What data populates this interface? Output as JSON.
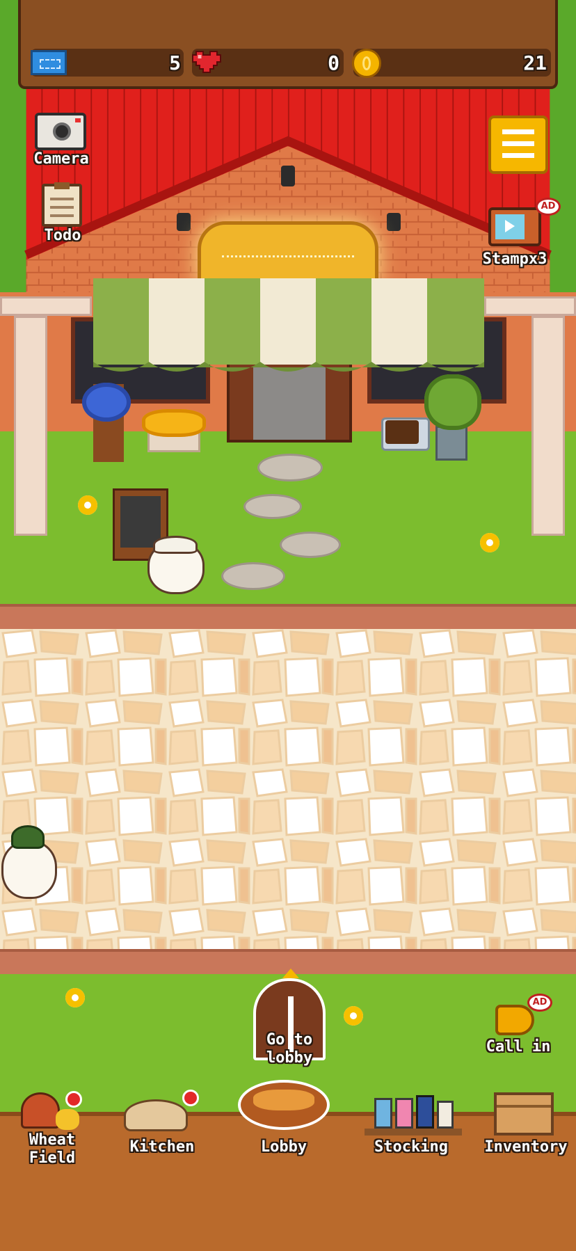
{
  "hud": {
    "tickets": "5",
    "hearts": "0",
    "coins": "21"
  },
  "side_buttons": {
    "camera": "Camera",
    "todo": "Todo",
    "stamp": "Stampx3",
    "stamp_badge": "AD",
    "menu_icon": "hamburger-menu-icon"
  },
  "scene": {
    "go_lobby": "Go to\nlobby",
    "call_in": "Call in",
    "call_in_badge": "AD"
  },
  "bottom_nav": [
    {
      "label": "Wheat\nField",
      "icon": "wheat-icon"
    },
    {
      "label": "Kitchen",
      "icon": "kitchen-icon"
    },
    {
      "label": "Lobby",
      "icon": "bread-basket-icon"
    },
    {
      "label": "Stocking",
      "icon": "shelf-icon"
    },
    {
      "label": "Inventory",
      "icon": "box-icon"
    }
  ],
  "colors": {
    "roof": "#e0201c",
    "awning_green": "#8cb04a",
    "awning_white": "#f2ead4",
    "grass": "#7cbd2e",
    "wood": "#b96a2c",
    "menu_button": "#f6b700"
  }
}
